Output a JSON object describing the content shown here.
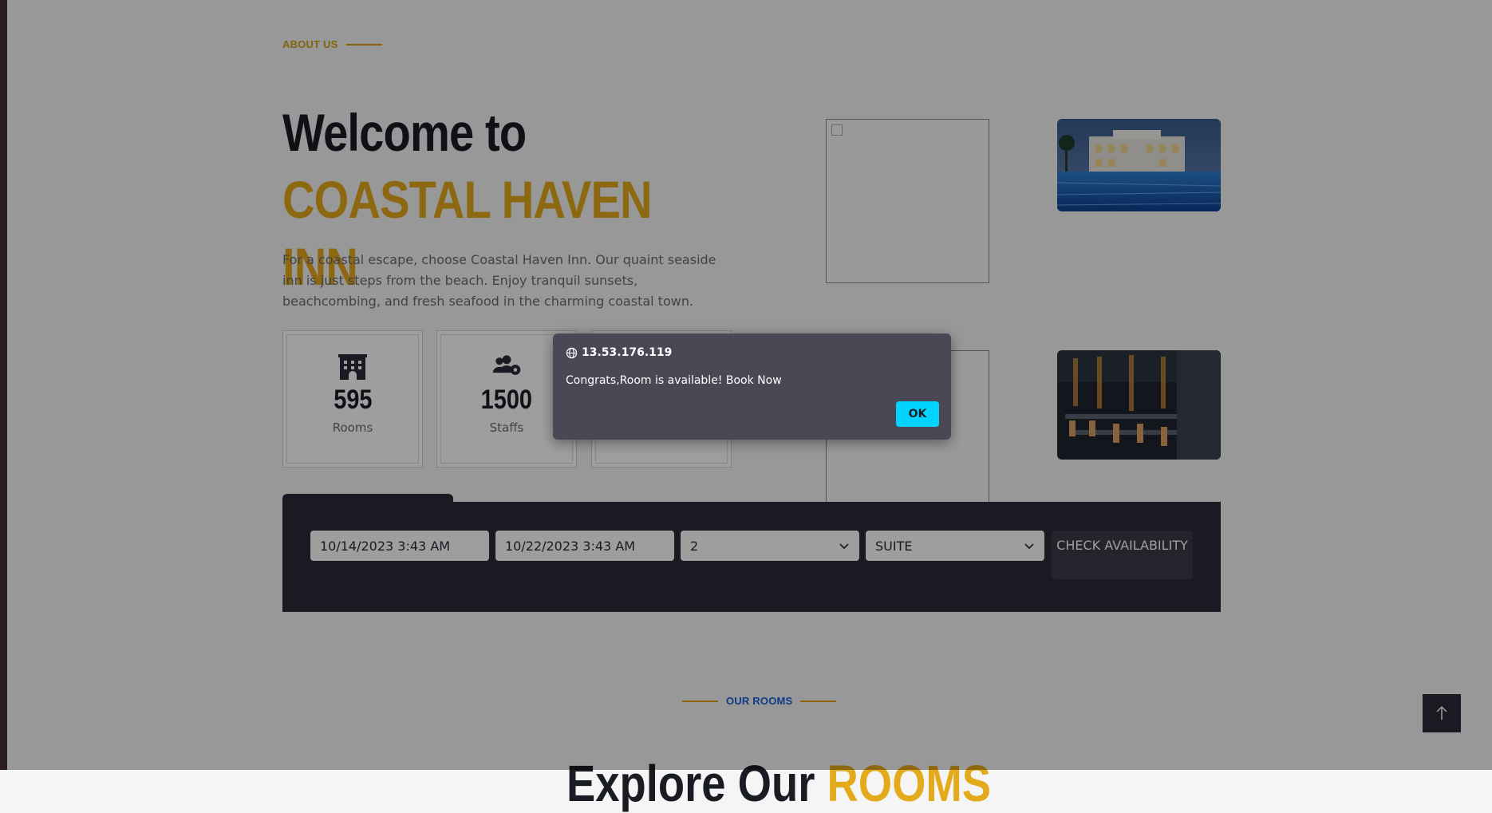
{
  "about": {
    "label": "About Us",
    "title_plain": "Welcome to",
    "title_accent": "COASTAL HAVEN INN",
    "description": "For a coastal escape, choose Coastal Haven Inn. Our quaint seaside inn is just steps from the beach. Enjoy tranquil sunsets, beachcombing, and fresh seafood in the charming coastal town."
  },
  "stats": [
    {
      "value": "595",
      "label": "Rooms",
      "icon": "hotel-icon"
    },
    {
      "value": "1500",
      "label": "Staffs",
      "icon": "users-cog-icon"
    },
    {
      "value": "",
      "label": "",
      "icon": "users-icon"
    }
  ],
  "booking": {
    "check_in": "10/14/2023 3:43 AM",
    "check_out": "10/22/2023 3:43 AM",
    "guests": "2",
    "room_type": "SUITE",
    "check_button": "CHECK AVAILABILITY"
  },
  "rooms": {
    "label": "Our Rooms",
    "title_plain": "Explore Our",
    "title_accent": "ROOMS"
  },
  "dialog": {
    "origin": "13.53.176.119",
    "message": "Congrats,Room is available! Book Now",
    "ok_label": "OK"
  },
  "colors": {
    "accent": "#e3aa1c",
    "dark": "#2b2d38",
    "dialog_bg": "#4a4855",
    "ok_button": "#00d4ff",
    "rooms_label": "#1b5fd8"
  }
}
